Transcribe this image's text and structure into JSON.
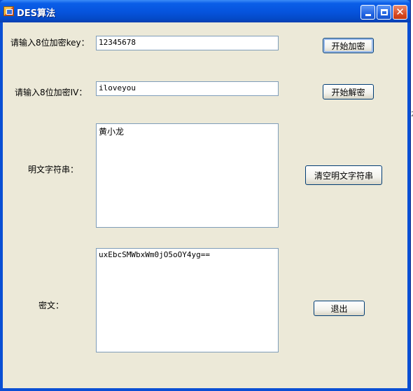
{
  "window": {
    "title": "DES算法"
  },
  "labels": {
    "key": "请输入8位加密key：",
    "iv": "请输入8位加密IV：",
    "plaintext": "明文字符串：",
    "ciphertext": "密文："
  },
  "fields": {
    "key": "12345678",
    "iv": "iloveyou",
    "plaintext": "黄小龙",
    "ciphertext": "uxEbcSMWbxWm0jO5oOY4yg=="
  },
  "buttons": {
    "encrypt": "开始加密",
    "decrypt": "开始解密",
    "clear": "清空明文字符串",
    "exit": "退出"
  },
  "icons": {
    "app": "app-window-icon",
    "minimize": "minimize-icon",
    "maximize": "maximize-icon",
    "close": "close-icon"
  },
  "colors": {
    "titlebar": "#0653dc",
    "client_bg": "#ece9d8",
    "field_border": "#7f9db9",
    "close_button": "#d6461e"
  },
  "edge_fragment": "2"
}
